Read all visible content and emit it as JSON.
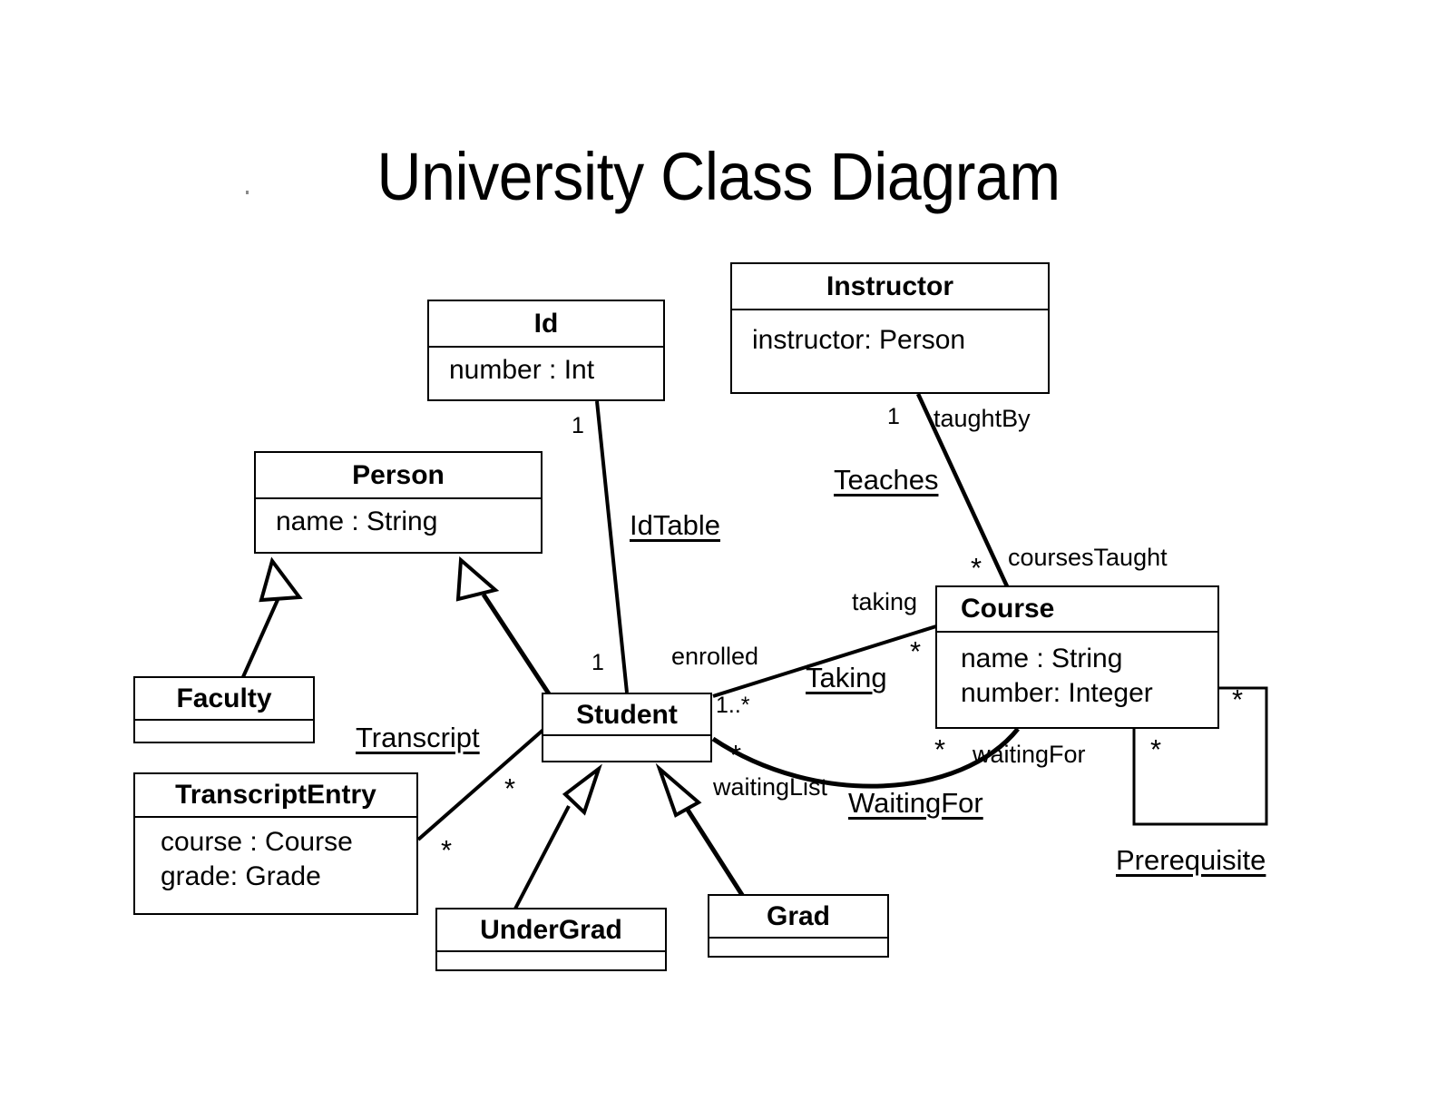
{
  "diagram": {
    "title": "University Class Diagram",
    "type": "uml-class-diagram"
  },
  "classes": [
    {
      "id": "id",
      "name": "Id",
      "attributes": [
        "number : Int"
      ]
    },
    {
      "id": "instructor",
      "name": "Instructor",
      "attributes": [
        "instructor: Person"
      ]
    },
    {
      "id": "person",
      "name": "Person",
      "attributes": [
        "name : String"
      ]
    },
    {
      "id": "faculty",
      "name": "Faculty",
      "attributes": []
    },
    {
      "id": "transcriptentry",
      "name": "TranscriptEntry",
      "attributes": [
        "course : Course",
        "grade: Grade"
      ]
    },
    {
      "id": "student",
      "name": "Student",
      "attributes": []
    },
    {
      "id": "undergrad",
      "name": "UnderGrad",
      "attributes": []
    },
    {
      "id": "grad",
      "name": "Grad",
      "attributes": []
    },
    {
      "id": "course",
      "name": "Course",
      "attributes": [
        "name : String",
        "number: Integer"
      ]
    }
  ],
  "associations": [
    {
      "id": "idtable",
      "name": "IdTable",
      "from": "id",
      "to": "student",
      "from_multiplicity": "1",
      "to_multiplicity": "1"
    },
    {
      "id": "teaches",
      "name": "Teaches",
      "from": "instructor",
      "to": "course",
      "from_multiplicity": "1",
      "from_role": "taughtBy",
      "to_multiplicity": "*",
      "to_role": "coursesTaught"
    },
    {
      "id": "taking",
      "name": "Taking",
      "from": "student",
      "to": "course",
      "from_multiplicity": "1..*",
      "from_role": "enrolled",
      "to_multiplicity": "*",
      "to_role": "taking"
    },
    {
      "id": "waitingfor",
      "name": "WaitingFor",
      "from": "student",
      "to": "course",
      "from_multiplicity": "*",
      "from_role": "waitingList",
      "to_multiplicity": "*",
      "to_role": "waitingFor"
    },
    {
      "id": "transcript",
      "name": "Transcript",
      "from": "transcriptentry",
      "to": "student",
      "from_multiplicity": "*",
      "to_multiplicity": "*"
    },
    {
      "id": "prerequisite",
      "name": "Prerequisite",
      "from": "course",
      "to": "course",
      "from_multiplicity": "*",
      "to_multiplicity": "*"
    }
  ],
  "generalizations": [
    {
      "id": "faculty-person",
      "sub": "faculty",
      "super": "person"
    },
    {
      "id": "student-person",
      "sub": "student",
      "super": "person"
    },
    {
      "id": "undergrad-student",
      "sub": "undergrad",
      "super": "student"
    },
    {
      "id": "grad-student",
      "sub": "grad",
      "super": "student"
    }
  ],
  "labels": {
    "idtable_name": "IdTable",
    "idtable_id_mult": "1",
    "idtable_student_mult": "1",
    "teaches_name": "Teaches",
    "teaches_taughtby_role": "taughtBy",
    "teaches_taughtby_mult": "1",
    "teaches_coursestaught_role": "coursesTaught",
    "teaches_coursestaught_mult": "*",
    "taking_name": "Taking",
    "taking_enrolled_role": "enrolled",
    "taking_enrolled_mult": "1..*",
    "taking_taking_role": "taking",
    "taking_taking_mult": "*",
    "waitingfor_name": "WaitingFor",
    "waitingfor_waitinglist_role": "waitingList",
    "waitingfor_waitinglist_mult": "*",
    "waitingfor_waitingfor_role": "waitingFor",
    "waitingfor_waitingfor_mult": "*",
    "transcript_name": "Transcript",
    "transcript_student_mult": "*",
    "transcript_entry_mult": "*",
    "prerequisite_name": "Prerequisite",
    "prerequisite_mult_right": "*",
    "prerequisite_mult_bottom": "*"
  },
  "colors": {
    "background": "#ffffff",
    "stroke": "#000000",
    "text": "#000000"
  }
}
